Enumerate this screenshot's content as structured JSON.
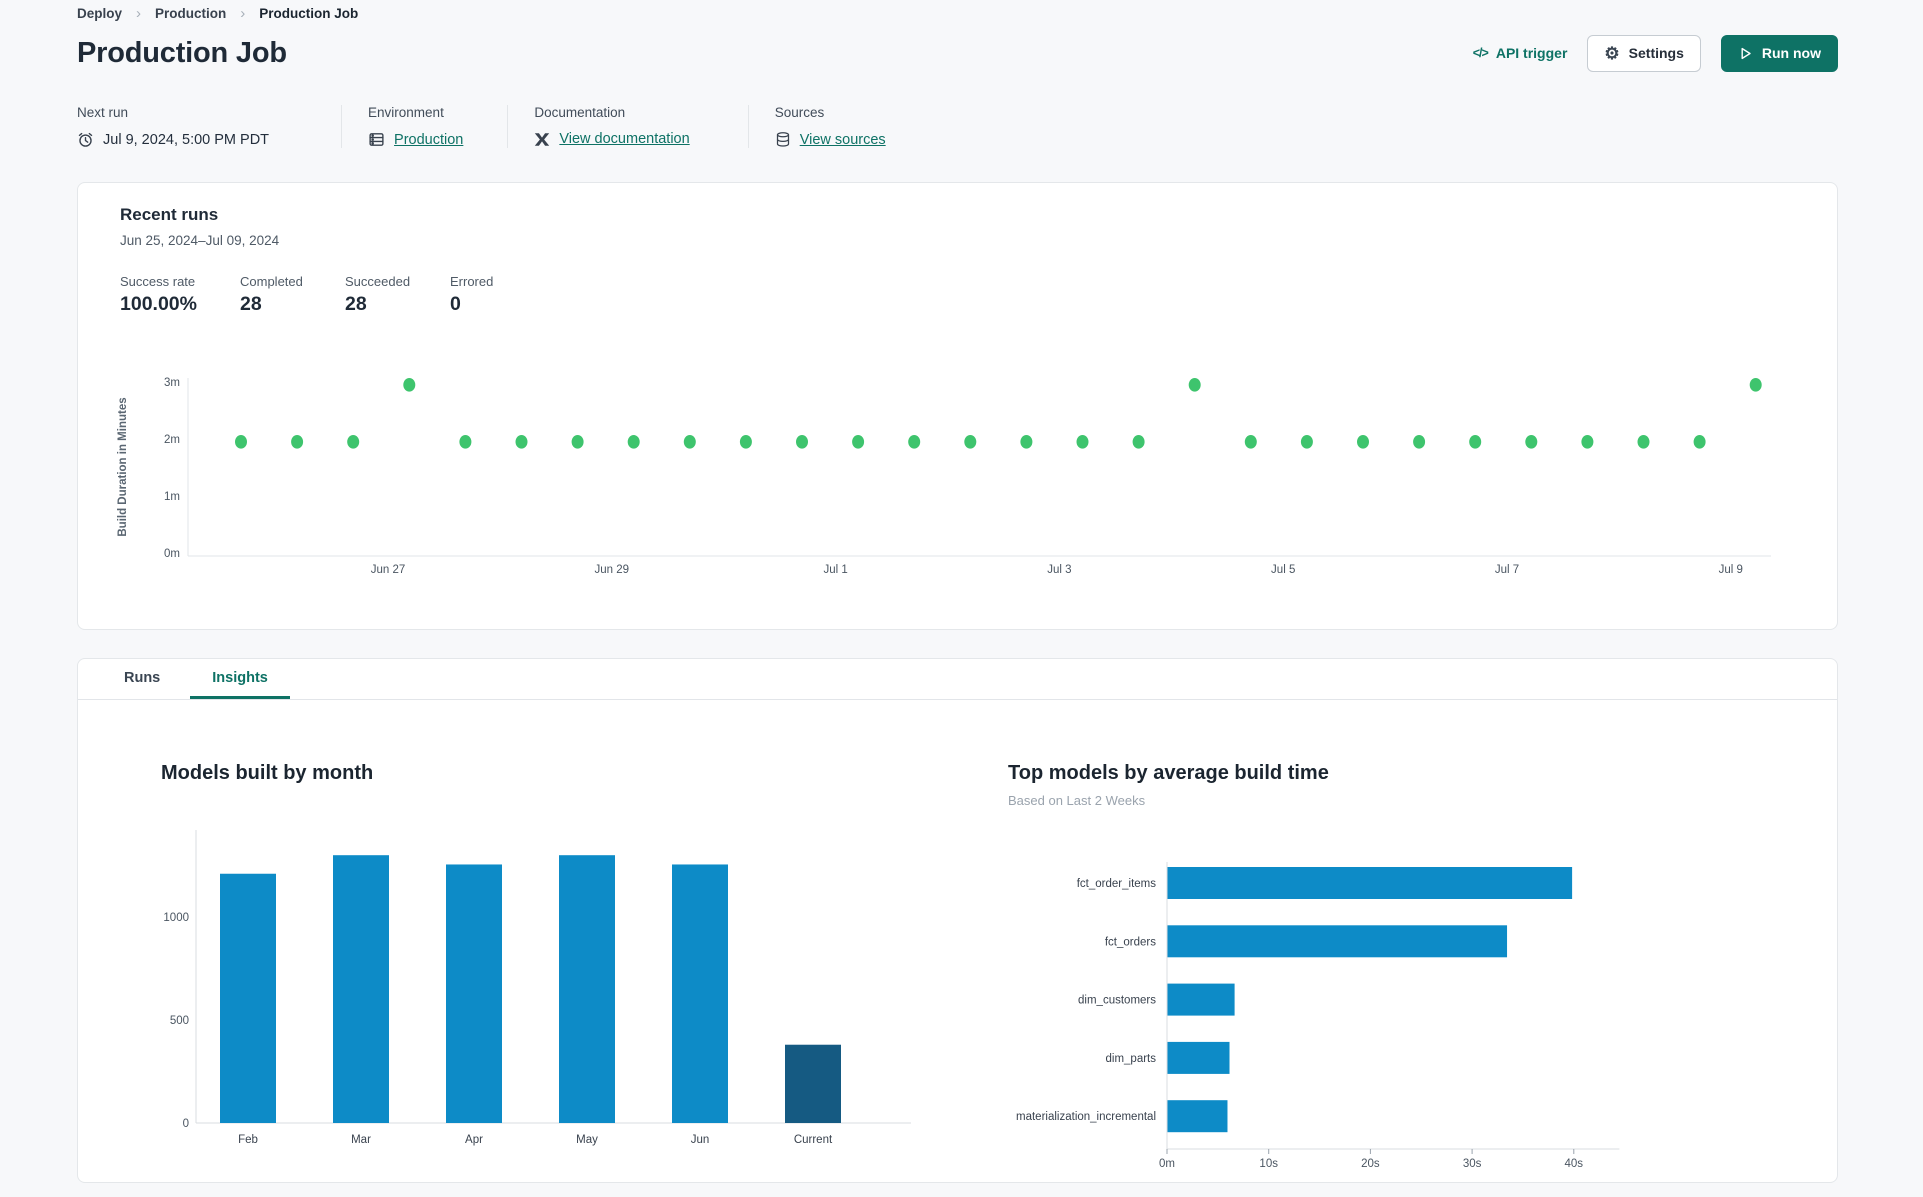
{
  "colors": {
    "accent_teal": "#0e7265",
    "success_green": "#3ec46d",
    "bar_blue": "#0d8bc7",
    "bar_dark_blue": "#155a82"
  },
  "breadcrumb": {
    "separator": "›",
    "items": [
      {
        "label": "Deploy"
      },
      {
        "label": "Production"
      },
      {
        "label": "Production Job"
      }
    ]
  },
  "header": {
    "title": "Production Job",
    "actions": {
      "api_trigger": {
        "icon_text": "</>",
        "label": "API trigger"
      },
      "settings": {
        "icon_text": "⚙",
        "label": "Settings"
      },
      "run_now": {
        "label": "Run now"
      }
    }
  },
  "info_bar": {
    "columns": [
      {
        "label": "Next run",
        "value": "Jul 9, 2024, 5:00 PM PDT"
      },
      {
        "label": "Environment",
        "value": "Production"
      },
      {
        "label": "Documentation",
        "value": "View documentation"
      },
      {
        "label": "Sources",
        "value": "View sources"
      }
    ]
  },
  "recent_runs": {
    "title": "Recent runs",
    "date_range": "Jun 25, 2024–Jul 09, 2024",
    "stats": [
      {
        "label": "Success rate",
        "value": "100.00%"
      },
      {
        "label": "Completed",
        "value": "28"
      },
      {
        "label": "Succeeded",
        "value": "28"
      },
      {
        "label": "Errored",
        "value": "0"
      }
    ]
  },
  "tabs": [
    {
      "label": "Runs",
      "active": false
    },
    {
      "label": "Insights",
      "active": true
    }
  ],
  "chart_data": [
    {
      "type": "scatter",
      "title": "Recent runs",
      "ylabel": "Build Duration in Minutes",
      "y_ticks": [
        "0m",
        "1m",
        "2m",
        "3m"
      ],
      "ylim_minutes": [
        0,
        3.25
      ],
      "x_tick_labels": [
        "Jun 27",
        "Jun 29",
        "Jul 1",
        "Jul 3",
        "Jul 5",
        "Jul 7",
        "Jul 9"
      ],
      "point_color": "#3ec46d",
      "points_minutes": [
        1.95,
        1.95,
        1.95,
        2.95,
        1.95,
        1.95,
        1.95,
        1.95,
        1.95,
        1.95,
        1.95,
        1.95,
        1.95,
        1.95,
        1.95,
        1.95,
        1.95,
        2.95,
        1.95,
        1.95,
        1.95,
        1.95,
        1.95,
        1.95,
        1.95,
        1.95,
        1.95,
        2.95
      ]
    },
    {
      "type": "bar",
      "title": "Models built by month",
      "categories": [
        "Feb",
        "Mar",
        "Apr",
        "May",
        "Jun",
        "Current"
      ],
      "values": [
        1210,
        1300,
        1255,
        1300,
        1255,
        380
      ],
      "bar_colors": [
        "#0d8bc7",
        "#0d8bc7",
        "#0d8bc7",
        "#0d8bc7",
        "#0d8bc7",
        "#155a82"
      ],
      "y_ticks": [
        0,
        500,
        1000
      ],
      "ylim": [
        0,
        1400
      ],
      "grid": false,
      "legend": false
    },
    {
      "type": "horizontal-bar",
      "title": "Top models by average build time",
      "subtitle": "Based on Last 2 Weeks",
      "categories": [
        "fct_order_items",
        "fct_orders",
        "dim_customers",
        "dim_parts",
        "materialization_incremental"
      ],
      "values_seconds": [
        39.8,
        33.4,
        6.6,
        6.1,
        5.9
      ],
      "bar_color": "#0d8bc7",
      "x_ticks": [
        "0m",
        "10s",
        "20s",
        "30s",
        "40s"
      ],
      "xlim_seconds": [
        0,
        44.5
      ],
      "grid": false,
      "legend": false
    }
  ]
}
